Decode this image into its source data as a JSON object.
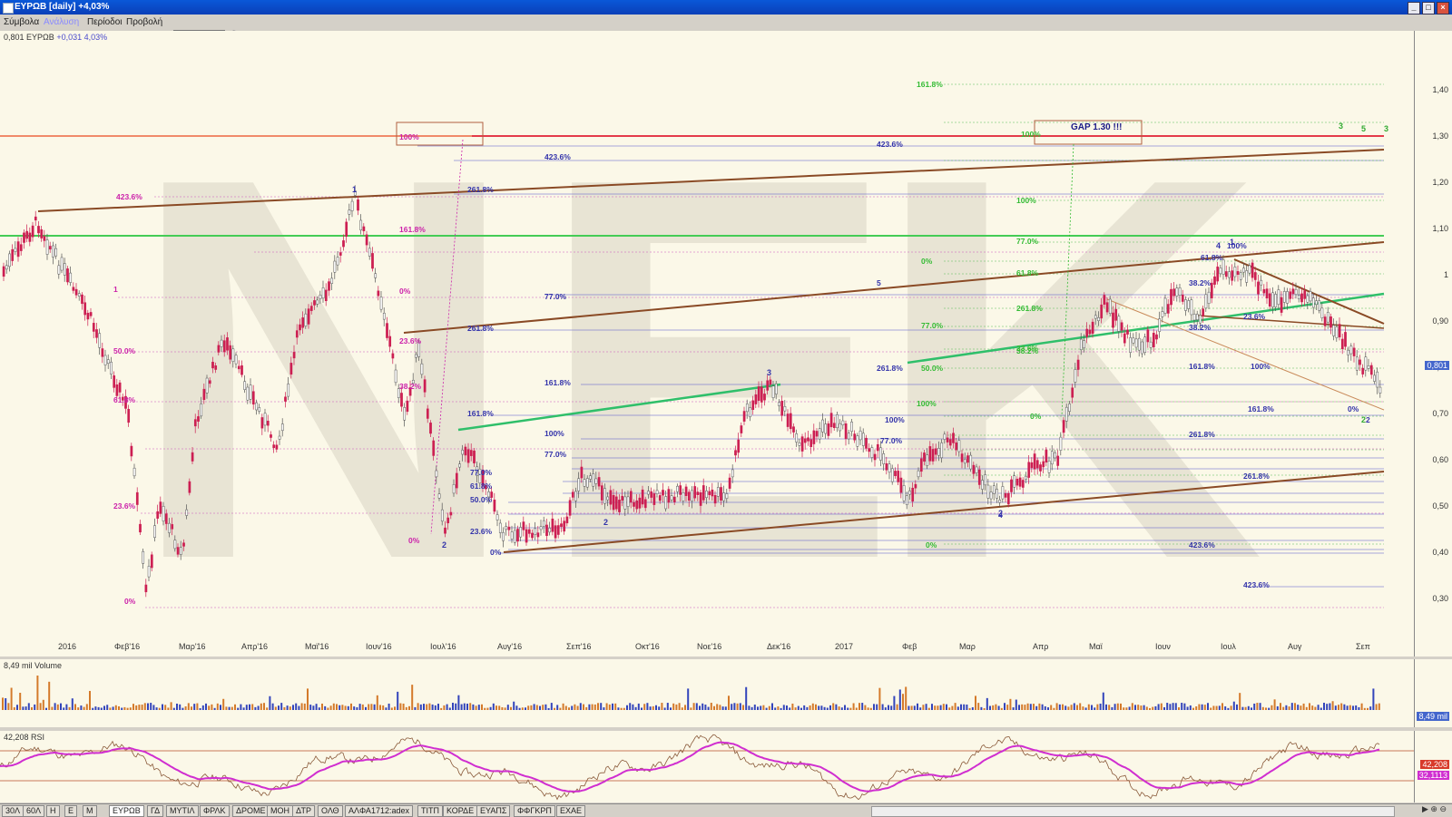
{
  "window": {
    "title": "ΕΥΡΩΒ [daily] +4,03%"
  },
  "menu": {
    "items": [
      "Σύμβολα",
      "Ανάλυση",
      "Περίοδοι",
      "Προβολή"
    ],
    "active_index": 1
  },
  "price_panel": {
    "symbol_value": "0,801",
    "symbol": "ΕΥΡΩΒ",
    "change": "+0,031",
    "change_pct": "4,03%",
    "last_price": "0,801",
    "watermark": "NEK",
    "y_ticks": [
      "1,40",
      "1,30",
      "1,20",
      "1,10",
      "1",
      "0,90",
      "0,80",
      "0,70",
      "0,60",
      "0,50",
      "0,40",
      "0,30"
    ],
    "x_ticks": [
      "2016",
      "Φεβ'16",
      "Μαρ'16",
      "Απρ'16",
      "Μαϊ'16",
      "Ιουν'16",
      "Ιουλ'16",
      "Αυγ'16",
      "Σεπ'16",
      "Οκτ'16",
      "Νοε'16",
      "Δεκ'16",
      "2017",
      "Φεβ",
      "Μαρ",
      "Απρ",
      "Μαϊ",
      "Ιουν",
      "Ιουλ",
      "Αυγ",
      "Σεπ"
    ],
    "annotation_gap": "GAP 1.30 !!!",
    "wave_labels": [
      "1",
      "2",
      "2",
      "3",
      "2",
      "4",
      "1",
      "5",
      "3",
      "3",
      "2"
    ],
    "fib_labels": [
      "161.8%",
      "100%",
      "100%",
      "423.6%",
      "423.6%",
      "261.8%",
      "100%",
      "423.6%",
      "77.0%",
      "161.8%",
      "61.8%",
      "100%",
      "0%",
      "1",
      "0%",
      "5",
      "77.0%",
      "61.8%",
      "261.8%",
      "261.8%",
      "50.0%",
      "23.6%",
      "38.2%",
      "77.0%",
      "38.2%",
      "261.8%",
      "50.0%",
      "38.2%",
      "100%",
      "161.8%",
      "61.8%",
      "100%",
      "23.6%",
      "38.2%",
      "0%",
      "161.8%",
      "77.0%",
      "0%",
      "23.6%",
      "161.8%",
      "100%",
      "100%",
      "77.0%",
      "0%",
      "161.8%",
      "261.8%",
      "0%",
      "23.6%",
      "50.0%",
      "61.8%",
      "77.0%",
      "261.8%",
      "423.6%",
      "23.6%",
      "0%",
      "2",
      "4",
      "0%",
      "423.6%"
    ]
  },
  "volume_panel": {
    "label": "8,49 mil Volume",
    "last": "8,49 mil"
  },
  "rsi_panel": {
    "label": "42,208 RSI",
    "last_rsi": "42,208",
    "last_ma": "32,1113"
  },
  "tabs": [
    "30Λ",
    "60Λ",
    "Η",
    "Ε",
    "Μ",
    "ΕΥΡΩΒ",
    "ΓΔ",
    "ΜΥΤΙΛ",
    "ΦΡΛΚ",
    "ΔΡΟΜΕ",
    "ΜΟΗ",
    "ΔΤΡ",
    "ΟΛΘ",
    "ΑΛΦΑ1712:adex",
    "ΤΙΤΠ",
    "ΚΟΡΔΕ",
    "ΕΥΑΠΣ",
    "ΦΦΓΚΡΠ",
    "ΕΧΑΕ"
  ],
  "active_tab_index": 5,
  "colors": {
    "up": "#555555",
    "down": "#cc1f52",
    "fib_magenta": "#cc22aa",
    "fib_blue": "#3333aa",
    "fib_green": "#33bb33",
    "channel_brown": "#8a4a25",
    "trend_green": "#2fbf6a",
    "rsi": "#d02ed0"
  }
}
